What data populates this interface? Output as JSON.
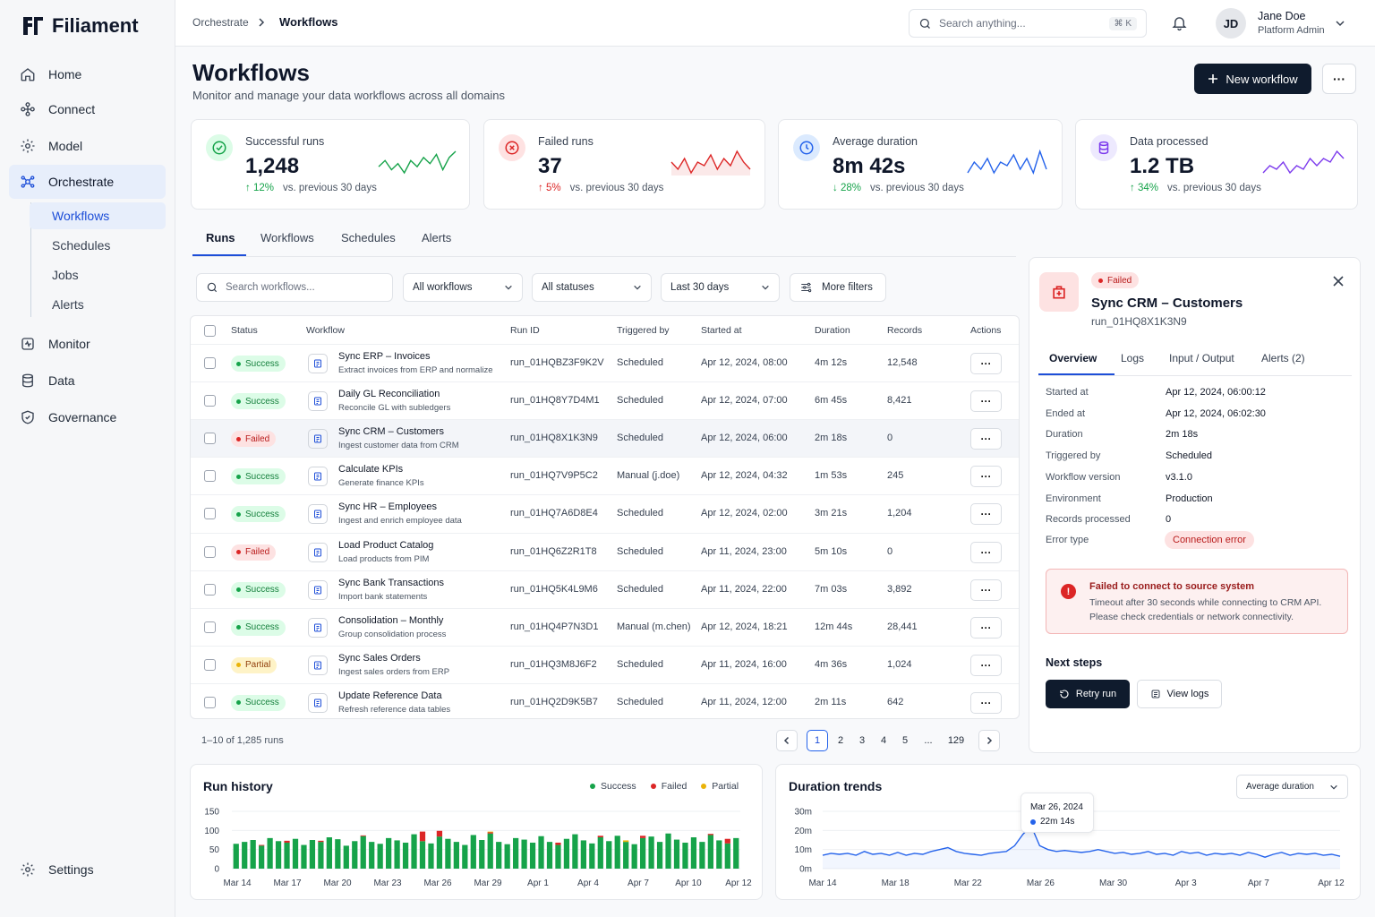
{
  "app": {
    "name": "Filiament"
  },
  "sidebar": {
    "items": [
      {
        "label": "Home"
      },
      {
        "label": "Connect"
      },
      {
        "label": "Model"
      },
      {
        "label": "Orchestrate"
      },
      {
        "label": "Monitor"
      },
      {
        "label": "Data"
      },
      {
        "label": "Governance"
      }
    ],
    "sub_items": [
      {
        "label": "Workflows"
      },
      {
        "label": "Schedules"
      },
      {
        "label": "Jobs"
      },
      {
        "label": "Alerts"
      }
    ],
    "settings_label": "Settings"
  },
  "topbar": {
    "breadcrumb": [
      "Orchestrate",
      "Workflows"
    ],
    "search_placeholder": "Search anything...",
    "search_shortcut": "⌘ K",
    "user": {
      "initials": "JD",
      "name": "Jane Doe",
      "role": "Platform Admin"
    }
  },
  "header": {
    "title": "Workflows",
    "subtitle": "Monitor and manage your data workflows across all domains",
    "new_button": "New workflow",
    "more_button": "···"
  },
  "kpis": [
    {
      "label": "Successful runs",
      "value": "1,248",
      "delta": "12%",
      "direction": "up",
      "compare": "vs. previous 30 days",
      "color": "#16a34a",
      "delta_color": "#16a34a",
      "spark": [
        5,
        7,
        4,
        6,
        3,
        7,
        5,
        8,
        6,
        9,
        4,
        8,
        10
      ]
    },
    {
      "label": "Failed runs",
      "value": "37",
      "delta": "5%",
      "direction": "up",
      "compare": "vs. previous 30 days",
      "color": "#dc2626",
      "delta_color": "#dc2626",
      "spark": [
        6,
        4,
        7,
        3,
        6,
        5,
        8,
        4,
        7,
        5,
        9,
        6,
        4
      ]
    },
    {
      "label": "Average duration",
      "value": "8m 42s",
      "delta": "28%",
      "direction": "down",
      "compare": "vs. previous 30 days",
      "color": "#2563eb",
      "delta_color": "#16a34a",
      "spark": [
        4,
        7,
        5,
        8,
        4,
        7,
        6,
        9,
        5,
        8,
        4,
        10,
        5
      ]
    },
    {
      "label": "Data processed",
      "value": "1.2 TB",
      "delta": "34%",
      "direction": "up",
      "compare": "vs. previous 30 days",
      "color": "#7c3aed",
      "delta_color": "#16a34a",
      "spark": [
        4,
        6,
        5,
        7,
        4,
        6,
        5,
        8,
        6,
        8,
        7,
        10,
        8
      ]
    }
  ],
  "tabs": [
    "Runs",
    "Workflows",
    "Schedules",
    "Alerts"
  ],
  "filters": {
    "search_placeholder": "Search workflows...",
    "workflow": "All workflows",
    "status": "All statuses",
    "range": "Last 30 days",
    "more": "More filters"
  },
  "table": {
    "headers": [
      "Status",
      "Workflow",
      "Run ID",
      "Triggered by",
      "Started at",
      "Duration",
      "Records",
      "Actions"
    ],
    "rows": [
      {
        "status": "Success",
        "name": "Sync ERP – Invoices",
        "desc": "Extract invoices from ERP and normalize",
        "run_id": "run_01HQBZ3F9K2V",
        "trigger": "Scheduled",
        "started": "Apr 12, 2024, 08:00",
        "duration": "4m 12s",
        "records": "12,548",
        "icon": "sync-icon"
      },
      {
        "status": "Success",
        "name": "Daily GL Reconciliation",
        "desc": "Reconcile GL with subledgers",
        "run_id": "run_01HQ8Y7D4M1",
        "trigger": "Scheduled",
        "started": "Apr 12, 2024, 07:00",
        "duration": "6m 45s",
        "records": "8,421",
        "icon": "ledger-icon"
      },
      {
        "status": "Failed",
        "name": "Sync CRM – Customers",
        "desc": "Ingest customer data from CRM",
        "run_id": "run_01HQ8X1K3N9",
        "trigger": "Scheduled",
        "started": "Apr 12, 2024, 06:00",
        "duration": "2m 18s",
        "records": "0",
        "icon": "crm-icon"
      },
      {
        "status": "Success",
        "name": "Calculate KPIs",
        "desc": "Generate finance KPIs",
        "run_id": "run_01HQ7V9P5C2",
        "trigger": "Manual (j.doe)",
        "started": "Apr 12, 2024, 04:32",
        "duration": "1m 53s",
        "records": "245",
        "icon": "chart-icon"
      },
      {
        "status": "Success",
        "name": "Sync HR – Employees",
        "desc": "Ingest and enrich employee data",
        "run_id": "run_01HQ7A6D8E4",
        "trigger": "Scheduled",
        "started": "Apr 12, 2024, 02:00",
        "duration": "3m 21s",
        "records": "1,204",
        "icon": "people-icon"
      },
      {
        "status": "Failed",
        "name": "Load Product Catalog",
        "desc": "Load products from PIM",
        "run_id": "run_01HQ6Z2R1T8",
        "trigger": "Scheduled",
        "started": "Apr 11, 2024, 23:00",
        "duration": "5m 10s",
        "records": "0",
        "icon": "catalog-icon"
      },
      {
        "status": "Success",
        "name": "Sync Bank Transactions",
        "desc": "Import bank statements",
        "run_id": "run_01HQ5K4L9M6",
        "trigger": "Scheduled",
        "started": "Apr 11, 2024, 22:00",
        "duration": "7m 03s",
        "records": "3,892",
        "icon": "bank-icon"
      },
      {
        "status": "Success",
        "name": "Consolidation – Monthly",
        "desc": "Group consolidation process",
        "run_id": "run_01HQ4P7N3D1",
        "trigger": "Manual (m.chen)",
        "started": "Apr 12, 2024, 18:21",
        "duration": "12m 44s",
        "records": "28,441",
        "icon": "consolidation-icon"
      },
      {
        "status": "Partial",
        "name": "Sync Sales Orders",
        "desc": "Ingest sales orders from ERP",
        "run_id": "run_01HQ3M8J6F2",
        "trigger": "Scheduled",
        "started": "Apr 11, 2024, 16:00",
        "duration": "4m 36s",
        "records": "1,024",
        "icon": "orders-icon"
      },
      {
        "status": "Success",
        "name": "Update Reference Data",
        "desc": "Refresh reference data tables",
        "run_id": "run_01HQ2D9K5B7",
        "trigger": "Scheduled",
        "started": "Apr 11, 2024, 12:00",
        "duration": "2m 11s",
        "records": "642",
        "icon": "reference-icon"
      }
    ]
  },
  "pagination": {
    "summary": "1–10 of 1,285 runs",
    "pages": [
      "1",
      "2",
      "3",
      "4",
      "5",
      "...",
      "129"
    ],
    "current": "1"
  },
  "detail": {
    "status": "Failed",
    "title": "Sync CRM – Customers",
    "run_id": "run_01HQ8X1K3N9",
    "tabs": [
      "Overview",
      "Logs",
      "Input / Output",
      "Alerts (2)"
    ],
    "fields": [
      {
        "k": "Started at",
        "v": "Apr 12, 2024, 06:00:12"
      },
      {
        "k": "Ended at",
        "v": "Apr 12, 2024, 06:02:30"
      },
      {
        "k": "Duration",
        "v": "2m 18s"
      },
      {
        "k": "Triggered by",
        "v": "Scheduled"
      },
      {
        "k": "Workflow version",
        "v": "v3.1.0"
      },
      {
        "k": "Environment",
        "v": "Production"
      },
      {
        "k": "Records processed",
        "v": "0"
      }
    ],
    "error_type_label": "Error type",
    "error_type": "Connection error",
    "error_title": "Failed to connect to source system",
    "error_line1": "Timeout after 30 seconds while connecting to CRM API.",
    "error_line2": "Please check credentials or network connectivity.",
    "next_steps": "Next steps",
    "retry": "Retry run",
    "view_logs": "View logs"
  },
  "run_history": {
    "title": "Run history",
    "legend": [
      {
        "name": "Success",
        "color": "#16a34a"
      },
      {
        "name": "Failed",
        "color": "#dc2626"
      },
      {
        "name": "Partial",
        "color": "#eab308"
      }
    ],
    "y_ticks": [
      "150",
      "100",
      "50",
      "0"
    ],
    "x_ticks": [
      "Mar 14",
      "Mar 17",
      "Mar 20",
      "Mar 23",
      "Mar 26",
      "Mar 29",
      "Apr 1",
      "Apr 4",
      "Apr 7",
      "Apr 10",
      "Apr 12"
    ]
  },
  "duration_trends": {
    "title": "Duration trends",
    "select": "Average duration",
    "y_ticks": [
      "30m",
      "20m",
      "10m",
      "0m"
    ],
    "x_ticks": [
      "Mar 14",
      "Mar 18",
      "Mar 22",
      "Mar 26",
      "Mar 30",
      "Apr 3",
      "Apr 7",
      "Apr 12"
    ],
    "tooltip_date": "Mar 26, 2024",
    "tooltip_value": "22m 14s"
  },
  "chart_data": [
    {
      "type": "bar",
      "title": "Run history",
      "ylim": [
        0,
        150
      ],
      "series": [
        {
          "name": "Success",
          "values": [
            65,
            70,
            75,
            60,
            80,
            72,
            68,
            78,
            62,
            75,
            70,
            82,
            77,
            60,
            72,
            85,
            70,
            65,
            80,
            74,
            68,
            90,
            72,
            66,
            84,
            78,
            70,
            62,
            88,
            75,
            92,
            70,
            64,
            80,
            76,
            68,
            85,
            70,
            62,
            78,
            90,
            74,
            66,
            82,
            72,
            86,
            70,
            64,
            80,
            84,
            70,
            92,
            76,
            68,
            82,
            70,
            88,
            74,
            66,
            80
          ]
        },
        {
          "name": "Failed",
          "values": [
            0,
            0,
            0,
            2,
            0,
            0,
            5,
            0,
            0,
            0,
            3,
            0,
            0,
            0,
            0,
            2,
            0,
            0,
            0,
            0,
            0,
            0,
            25,
            0,
            15,
            0,
            0,
            0,
            0,
            0,
            3,
            0,
            0,
            0,
            0,
            0,
            0,
            0,
            6,
            0,
            0,
            0,
            0,
            4,
            0,
            0,
            0,
            0,
            6,
            0,
            0,
            0,
            0,
            0,
            0,
            0,
            3,
            0,
            12,
            0
          ]
        },
        {
          "name": "Partial",
          "values": [
            0,
            0,
            0,
            0,
            0,
            0,
            0,
            0,
            0,
            0,
            0,
            0,
            0,
            0,
            0,
            0,
            0,
            0,
            0,
            0,
            0,
            0,
            0,
            0,
            0,
            0,
            0,
            0,
            0,
            0,
            2,
            0,
            0,
            0,
            0,
            0,
            0,
            0,
            0,
            0,
            0,
            0,
            0,
            0,
            0,
            0,
            4,
            0,
            0,
            0,
            0,
            0,
            0,
            0,
            0,
            0,
            0,
            0,
            0,
            0
          ]
        }
      ]
    },
    {
      "type": "line",
      "title": "Duration trends",
      "ylabel": "Average duration",
      "ylim": [
        0,
        30
      ],
      "series": [
        {
          "name": "Average duration",
          "values": [
            7,
            8,
            7.5,
            8,
            7,
            9,
            7.5,
            8,
            7,
            8.5,
            7,
            8,
            7.5,
            9,
            10,
            11,
            9,
            8,
            7.5,
            7,
            8,
            8.5,
            9,
            12,
            18,
            22.2,
            12,
            10,
            9,
            9.5,
            9,
            8.5,
            9,
            10,
            9,
            8,
            8.5,
            7.5,
            8,
            9,
            7.5,
            8,
            7,
            9,
            8,
            8.5,
            7,
            8,
            7.5,
            8,
            7,
            8.5,
            7.5,
            6,
            7.5,
            8.5,
            7,
            8,
            7.5,
            8,
            7,
            7.5,
            6.5
          ]
        }
      ]
    }
  ]
}
